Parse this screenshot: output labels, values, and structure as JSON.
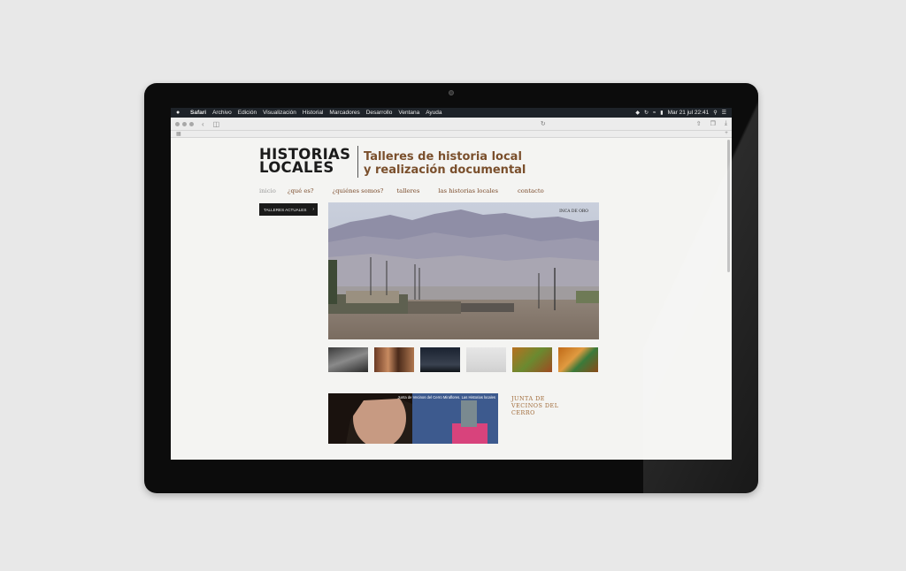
{
  "menubar": {
    "items": [
      "Safari",
      "Archivo",
      "Edición",
      "Visualización",
      "Historial",
      "Marcadores",
      "Desarrollo",
      "Ventana",
      "Ayuda"
    ],
    "clock": "Mar 21 jul  22:41"
  },
  "site": {
    "logo_line1": "HISTORIAS",
    "logo_line2": "LOCALES",
    "tagline_line1": "Talleres de historia local",
    "tagline_line2": "y realización documental",
    "nav": [
      "inicio",
      "¿qué es?",
      "¿quiénes somos?",
      "talleres",
      "las historias locales",
      "contacto"
    ],
    "side_button": "TALLERES ACTUALES",
    "hero_label": "INCA DE ORO",
    "feature_caption": "Junta de Vecinos del Cerro Miraflores. Las Historias locales",
    "feature_title": "JUNTA DE VECINOS DEL CERRO"
  },
  "icons": {
    "apple": "apple-icon",
    "back": "chevron-left-icon",
    "sidebar": "sidebar-icon",
    "reload": "reload-icon",
    "share": "share-icon",
    "tabs": "tabs-icon",
    "download": "download-icon",
    "bookmarks": "grid-icon",
    "new_tab": "plus-icon"
  },
  "colors": {
    "brand_brown": "#7a4f2c",
    "nav_active": "#9a9a9a",
    "feature_title": "#a06a38"
  }
}
